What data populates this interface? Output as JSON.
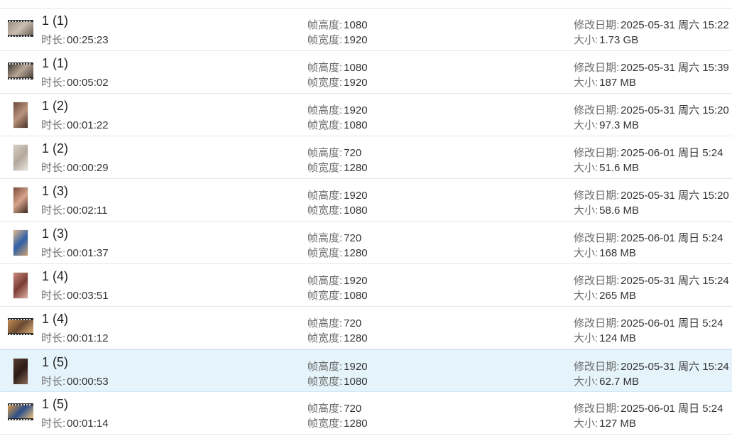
{
  "labels": {
    "duration": "时长:",
    "frame_height": "帧高度:",
    "frame_width": "帧宽度:",
    "modified": "修改日期:",
    "size": "大小:"
  },
  "files": [
    {
      "name": "1 (1)",
      "duration": "00:25:23",
      "frame_height": "1080",
      "frame_width": "1920",
      "modified": "2025-05-31 周六 15:22",
      "size": "1.73 GB",
      "thumb": {
        "shape": "landscape",
        "colors": [
          "#9b8e80",
          "#c9beb1",
          "#6b6056"
        ]
      }
    },
    {
      "name": "1 (1)",
      "duration": "00:05:02",
      "frame_height": "1080",
      "frame_width": "1920",
      "modified": "2025-05-31 周六 15:39",
      "size": "187 MB",
      "thumb": {
        "shape": "landscape",
        "colors": [
          "#3f3a35",
          "#b8a595",
          "#4a423b"
        ]
      }
    },
    {
      "name": "1 (2)",
      "duration": "00:01:22",
      "frame_height": "1920",
      "frame_width": "1080",
      "modified": "2025-05-31 周六 15:20",
      "size": "97.3 MB",
      "thumb": {
        "shape": "portrait",
        "colors": [
          "#6b4a3b",
          "#b9937d",
          "#4b3127"
        ]
      }
    },
    {
      "name": "1 (2)",
      "duration": "00:00:29",
      "frame_height": "720",
      "frame_width": "1280",
      "modified": "2025-06-01 周日 5:24",
      "size": "51.6 MB",
      "thumb": {
        "shape": "portrait",
        "colors": [
          "#d9cfc5",
          "#b3a89c",
          "#e9e3dc"
        ]
      }
    },
    {
      "name": "1 (3)",
      "duration": "00:02:11",
      "frame_height": "1920",
      "frame_width": "1080",
      "modified": "2025-05-31 周六 15:20",
      "size": "58.6 MB",
      "thumb": {
        "shape": "portrait",
        "colors": [
          "#7a4a3a",
          "#d6a38a",
          "#3c2820"
        ]
      }
    },
    {
      "name": "1 (3)",
      "duration": "00:01:37",
      "frame_height": "720",
      "frame_width": "1280",
      "modified": "2025-06-01 周日 5:24",
      "size": "168 MB",
      "thumb": {
        "shape": "portrait",
        "colors": [
          "#e2b88a",
          "#2f5fa8",
          "#caa070"
        ]
      }
    },
    {
      "name": "1 (4)",
      "duration": "00:03:51",
      "frame_height": "1920",
      "frame_width": "1080",
      "modified": "2025-05-31 周六 15:24",
      "size": "265 MB",
      "thumb": {
        "shape": "portrait",
        "colors": [
          "#c98c7e",
          "#7a3c35",
          "#e0b2a6"
        ]
      }
    },
    {
      "name": "1 (4)",
      "duration": "00:01:12",
      "frame_height": "720",
      "frame_width": "1280",
      "modified": "2025-06-01 周日 5:24",
      "size": "124 MB",
      "thumb": {
        "shape": "landscape",
        "colors": [
          "#c48b52",
          "#6a4a32",
          "#e0b07a"
        ]
      }
    },
    {
      "name": "1 (5)",
      "duration": "00:00:53",
      "frame_height": "1920",
      "frame_width": "1080",
      "modified": "2025-05-31 周六 15:24",
      "size": "62.7 MB",
      "thumb": {
        "shape": "portrait",
        "colors": [
          "#5a3d30",
          "#2a1b15",
          "#8a6a58"
        ]
      },
      "selected": true
    },
    {
      "name": "1 (5)",
      "duration": "00:01:14",
      "frame_height": "720",
      "frame_width": "1280",
      "modified": "2025-06-01 周日 5:24",
      "size": "127 MB",
      "thumb": {
        "shape": "landscape",
        "colors": [
          "#d99a48",
          "#2b4f8a",
          "#f0c27a"
        ]
      }
    }
  ]
}
